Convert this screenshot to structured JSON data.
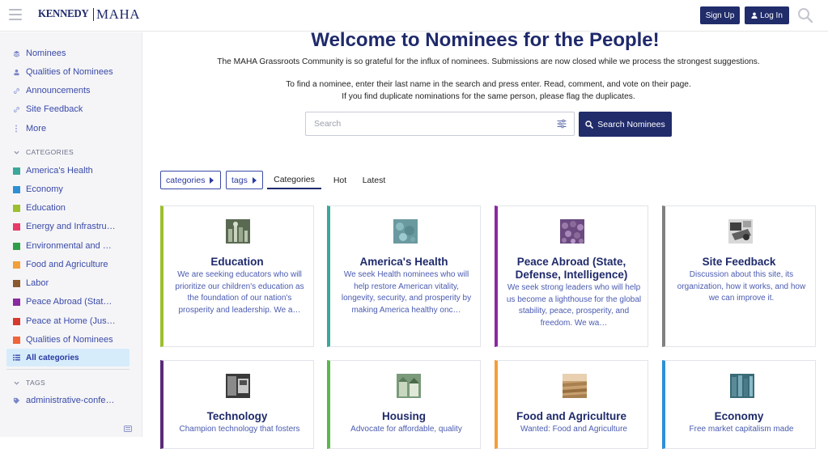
{
  "header": {
    "logo_left": "KENNEDY",
    "logo_right": "MAHA",
    "signup_label": "Sign Up",
    "login_label": "Log In"
  },
  "sidebar": {
    "top_items": [
      {
        "label": "Nominees",
        "icon": "layers-icon"
      },
      {
        "label": "Qualities of Nominees",
        "icon": "user-icon"
      },
      {
        "label": "Announcements",
        "icon": "link-icon"
      },
      {
        "label": "Site Feedback",
        "icon": "link-icon"
      },
      {
        "label": "More",
        "icon": "more-vertical-icon"
      }
    ],
    "categories_heading": "CATEGORIES",
    "categories": [
      {
        "label": "America's Health",
        "color": "#3aa89a"
      },
      {
        "label": "Economy",
        "color": "#2f8fd6"
      },
      {
        "label": "Education",
        "color": "#9cbf2e"
      },
      {
        "label": "Energy and Infrastru…",
        "color": "#e83a6b"
      },
      {
        "label": "Environmental and …",
        "color": "#2f9e4a"
      },
      {
        "label": "Food and Agriculture",
        "color": "#f2a03a"
      },
      {
        "label": "Labor",
        "color": "#8a5a2e"
      },
      {
        "label": "Peace Abroad (State…",
        "color": "#8a2aa0"
      },
      {
        "label": "Peace at Home (Jus…",
        "color": "#d63a2e"
      },
      {
        "label": "Qualities of Nominees",
        "color": "#f0643a"
      }
    ],
    "all_categories": "All categories",
    "tags_heading": "TAGS",
    "tags": [
      {
        "label": "administrative-confer…"
      }
    ]
  },
  "main": {
    "welcome": "Welcome to Nominees for the People!",
    "intro": "The MAHA Grassroots Community is so grateful for the influx of nominees. Submissions are now closed while we process the strongest suggestions.",
    "instr1": "To find a nominee, enter their last name in the search and press enter. Read, comment, and vote on their page.",
    "instr2": "If you find duplicate nominations for the same person, please flag the duplicates.",
    "search_placeholder": "Search",
    "search_button": "Search Nominees",
    "nav": {
      "categories_pill": "categories",
      "tags_pill": "tags",
      "tabs": [
        "Categories",
        "Hot",
        "Latest"
      ]
    },
    "cards": [
      {
        "title": "Education",
        "desc": "We are seeking educators who will prioritize our children's education as the foundation of our nation's prosperity and leadership. We a…",
        "color": "#9cbf2e"
      },
      {
        "title": "America's Health",
        "desc": "We seek Health nominees who will help restore American vitality, longevity, security, and prosperity by making America healthy onc…",
        "color": "#3aa89a"
      },
      {
        "title": "Peace Abroad (State, Defense, Intelligence)",
        "desc": "We seek strong leaders who will help us become a lighthouse for the global stability, peace, prosperity, and freedom. We wa…",
        "color": "#8a2aa0"
      },
      {
        "title": "Site Feedback",
        "desc": "Discussion about this site, its organization, how it works, and how we can improve it.",
        "color": "#808080"
      },
      {
        "title": "Technology",
        "desc": "Champion technology that fosters",
        "color": "#5a2a7a"
      },
      {
        "title": "Housing",
        "desc": "Advocate for affordable, quality",
        "color": "#5ab84a"
      },
      {
        "title": "Food and Agriculture",
        "desc": "Wanted: Food and Agriculture",
        "color": "#f2a03a"
      },
      {
        "title": "Economy",
        "desc": "Free market capitalism made",
        "color": "#2f8fd6"
      }
    ]
  }
}
